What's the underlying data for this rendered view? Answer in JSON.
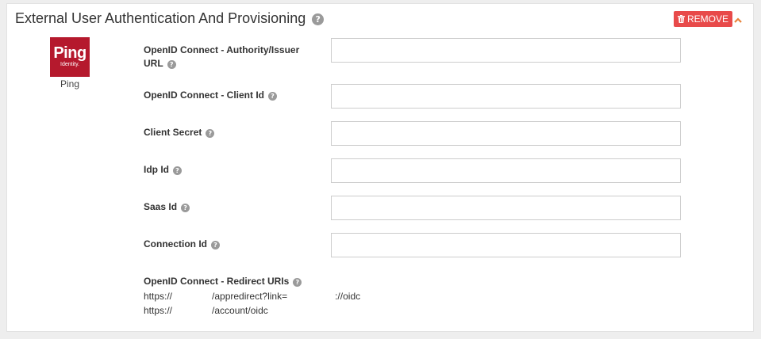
{
  "panel": {
    "title": "External User Authentication And Provisioning",
    "remove_label": "REMOVE"
  },
  "provider": {
    "logo_main": "Ping",
    "logo_sub": "Identity.",
    "caption": "Ping"
  },
  "fields": {
    "authority_url": {
      "label_line1": "OpenID Connect - Authority/Issuer",
      "label_line2": "URL",
      "value": ""
    },
    "client_id": {
      "label": "OpenID Connect - Client Id",
      "value": ""
    },
    "client_secret": {
      "label": "Client Secret",
      "value": ""
    },
    "idp_id": {
      "label": "Idp Id",
      "value": ""
    },
    "saas_id": {
      "label": "Saas Id",
      "value": ""
    },
    "connection_id": {
      "label": "Connection Id",
      "value": ""
    }
  },
  "redirect_uris": {
    "label": "OpenID Connect - Redirect URIs",
    "uris": [
      "https://               /appredirect?link=                  ://oidc",
      "https://               /account/oidc"
    ]
  },
  "colors": {
    "remove_button": "#e84a4a",
    "chevron": "#e8823a",
    "logo_bg": "#b5192d"
  }
}
